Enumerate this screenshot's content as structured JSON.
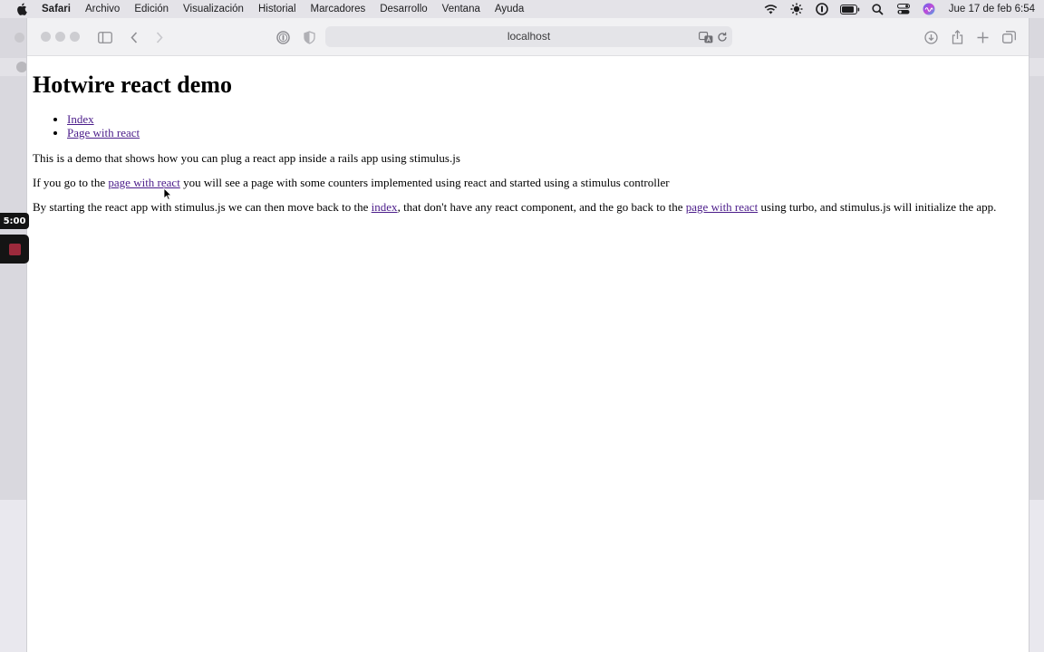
{
  "menubar": {
    "app_name": "Safari",
    "items": [
      "Archivo",
      "Edición",
      "Visualización",
      "Historial",
      "Marcadores",
      "Desarrollo",
      "Ventana",
      "Ayuda"
    ],
    "clock": "Jue 17 de feb  6:54"
  },
  "browser": {
    "url": "localhost"
  },
  "page": {
    "title": "Hotwire react demo",
    "nav": [
      "Index",
      "Page with react"
    ],
    "p1": "This is a demo that shows how you can plug a react app inside a rails app using stimulus.js",
    "p2": {
      "before": "If you go to the ",
      "link": "page with react",
      "after": " you will see a page with some counters implemented using react and started using a stimulus controller"
    },
    "p3": {
      "before": "By starting the react app with stimulus.js we can then move back to the ",
      "link1": "index",
      "middle": ", that don't have any react component, and the go back to the ",
      "link2": "page with react",
      "after": " using turbo, and stimulus.js will initialize the app."
    }
  },
  "recording": {
    "timer": "5:00"
  },
  "colors": {
    "link": "#4b1c8a",
    "record": "#9c2a3c"
  }
}
